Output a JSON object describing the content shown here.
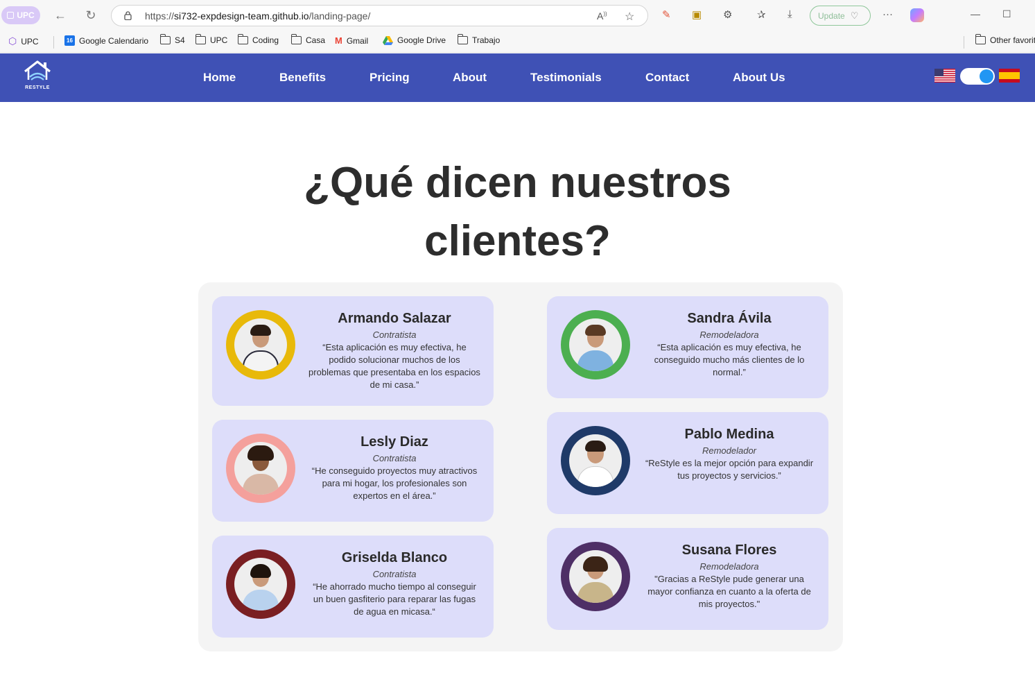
{
  "browser": {
    "profile_label": "UPC",
    "url_prefix": "https://",
    "url_host": "si732-expdesign-team.github.io",
    "url_path": "/landing-page/",
    "update_label": "Update"
  },
  "bookmarks": [
    "UPC",
    "Google Calendario",
    "S4",
    "UPC",
    "Coding",
    "Casa",
    "Gmail",
    "Google Drive",
    "Trabajo"
  ],
  "other_favorites": "Other favorit",
  "site": {
    "logo_text": "RESTYLE",
    "nav": [
      "Home",
      "Benefits",
      "Pricing",
      "About",
      "Testimonials",
      "Contact",
      "About Us"
    ]
  },
  "section": {
    "title_line1": "¿Qué dicen nuestros",
    "title_line2": "clientes?"
  },
  "testimonials": [
    {
      "name": "Armando Salazar",
      "role": "Contratista",
      "quote": "“Esta aplicación es muy efectiva, he podido solucionar muchos de los problemas que presentaba en los espacios de mi casa.”",
      "ring": "#e8b90a"
    },
    {
      "name": "Sandra Ávila",
      "role": "Remodeladora",
      "quote": "“Esta aplicación es muy efectiva, he conseguido mucho más clientes de lo normal.”",
      "ring": "#4caf50"
    },
    {
      "name": "Lesly Diaz",
      "role": "Contratista",
      "quote": "“He conseguido proyectos muy atractivos para mi hogar, los profesionales son expertos en el área.”",
      "ring": "#f4a09c"
    },
    {
      "name": "Pablo Medina",
      "role": "Remodelador",
      "quote": "“ReStyle es la mejor opción para expandir tus proyectos y servicios.”",
      "ring": "#1f3a68"
    },
    {
      "name": "Griselda Blanco",
      "role": "Contratista",
      "quote": "“He ahorrado mucho tiempo al conseguir un buen gasfiterio para reparar las fugas de agua en micasa.“",
      "ring": "#7a1f22"
    },
    {
      "name": "Susana Flores",
      "role": "Remodeladora",
      "quote": "\"Gracias a ReStyle pude generar una mayor confianza en cuanto a la oferta de mis proyectos.\"",
      "ring": "#4e2f66"
    }
  ]
}
